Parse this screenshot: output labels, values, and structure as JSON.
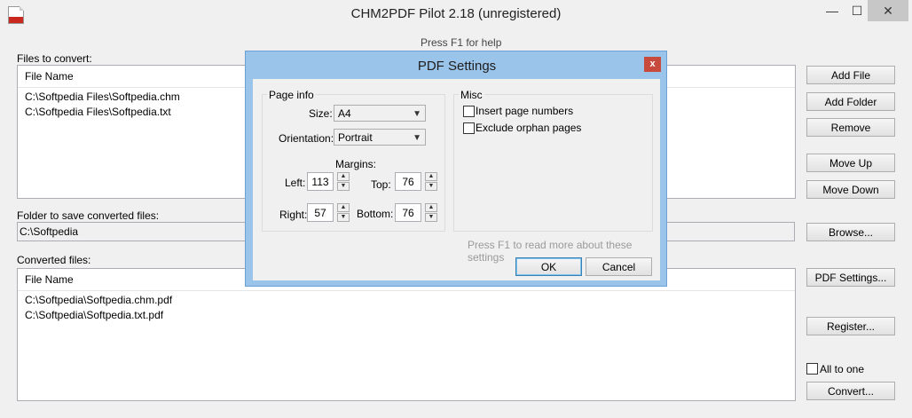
{
  "window": {
    "title": "CHM2PDF Pilot 2.18 (unregistered)",
    "hint": "Press F1 for help",
    "minimize": "—",
    "maximize": "☐",
    "close": "✕"
  },
  "files_to_convert": {
    "label": "Files to convert:",
    "header": "File Name",
    "rows": [
      "C:\\Softpedia Files\\Softpedia.chm",
      "C:\\Softpedia Files\\Softpedia.txt"
    ]
  },
  "folder": {
    "label": "Folder to save converted files:",
    "value": "C:\\Softpedia"
  },
  "converted": {
    "label": "Converted files:",
    "header": "File Name",
    "rows": [
      "C:\\Softpedia\\Softpedia.chm.pdf",
      "C:\\Softpedia\\Softpedia.txt.pdf"
    ]
  },
  "buttons": {
    "add_file": "Add File",
    "add_folder": "Add Folder",
    "remove": "Remove",
    "move_up": "Move Up",
    "move_down": "Move Down",
    "browse": "Browse...",
    "pdf_settings": "PDF Settings...",
    "register": "Register...",
    "convert": "Convert..."
  },
  "all_to_one": {
    "label": "All to one",
    "checked": false
  },
  "dialog": {
    "title": "PDF Settings",
    "close": "x",
    "page_info": {
      "title": "Page info",
      "size_label": "Size:",
      "size_value": "A4",
      "orientation_label": "Orientation:",
      "orientation_value": "Portrait",
      "margins_label": "Margins:",
      "left_label": "Left:",
      "left_value": "113",
      "top_label": "Top:",
      "top_value": "76",
      "right_label": "Right:",
      "right_value": "57",
      "bottom_label": "Bottom:",
      "bottom_value": "76"
    },
    "misc": {
      "title": "Misc",
      "insert_page_numbers": "Insert page numbers",
      "exclude_orphan_pages": "Exclude orphan pages"
    },
    "hint": "Press F1 to read more about these settings",
    "ok": "OK",
    "cancel": "Cancel"
  }
}
